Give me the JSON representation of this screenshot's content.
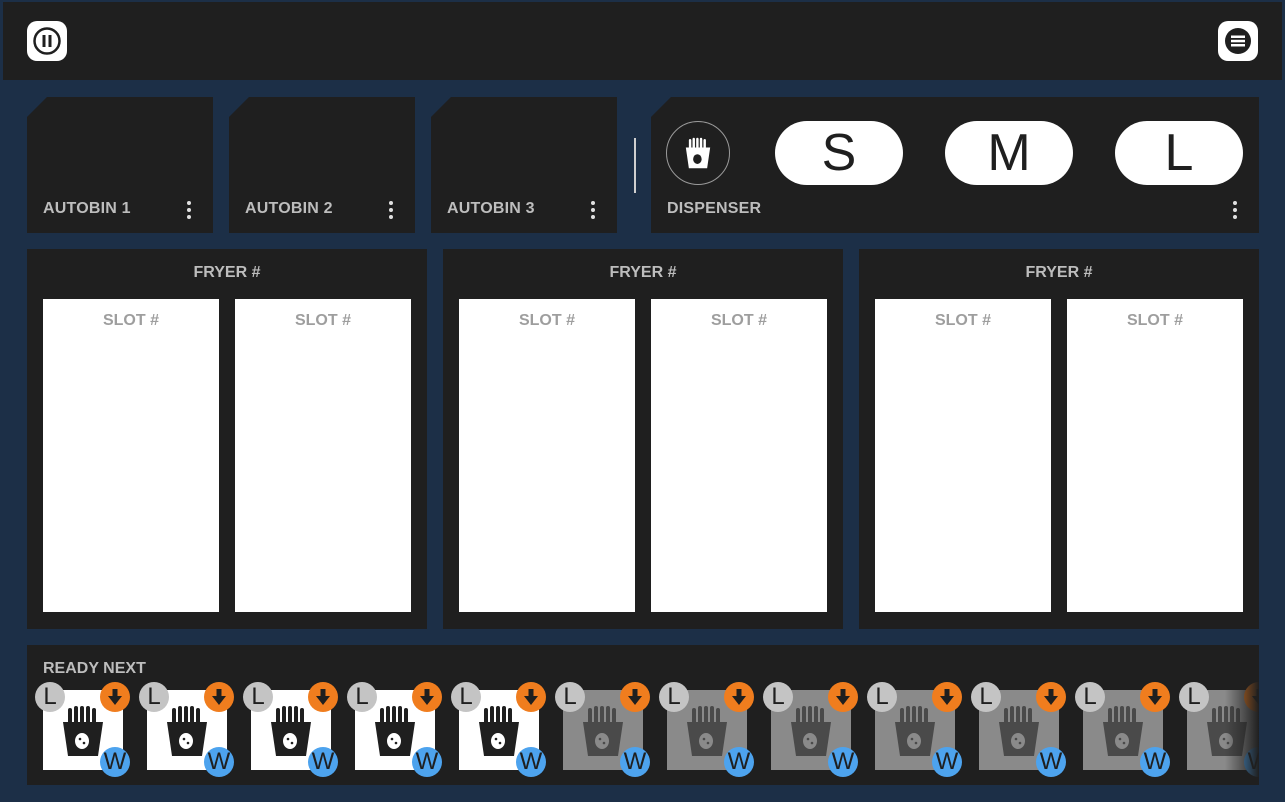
{
  "autobins": [
    {
      "label": "AUTOBIN 1"
    },
    {
      "label": "AUTOBIN 2"
    },
    {
      "label": "AUTOBIN 3"
    }
  ],
  "dispenser": {
    "label": "DISPENSER",
    "sizes": [
      "S",
      "M",
      "L"
    ]
  },
  "fryers": [
    {
      "title": "FRYER #",
      "slots": [
        "SLOT #",
        "SLOT #"
      ]
    },
    {
      "title": "FRYER #",
      "slots": [
        "SLOT #",
        "SLOT #"
      ]
    },
    {
      "title": "FRYER #",
      "slots": [
        "SLOT #",
        "SLOT #"
      ]
    }
  ],
  "ready_next": {
    "title": "READY NEXT",
    "items": [
      {
        "size": "L",
        "tag": "W",
        "state": "ready"
      },
      {
        "size": "L",
        "tag": "W",
        "state": "ready"
      },
      {
        "size": "L",
        "tag": "W",
        "state": "ready"
      },
      {
        "size": "L",
        "tag": "W",
        "state": "ready"
      },
      {
        "size": "L",
        "tag": "W",
        "state": "ready"
      },
      {
        "size": "L",
        "tag": "W",
        "state": "pending"
      },
      {
        "size": "L",
        "tag": "W",
        "state": "pending"
      },
      {
        "size": "L",
        "tag": "W",
        "state": "pending"
      },
      {
        "size": "L",
        "tag": "W",
        "state": "pending"
      },
      {
        "size": "L",
        "tag": "W",
        "state": "pending"
      },
      {
        "size": "L",
        "tag": "W",
        "state": "pending"
      },
      {
        "size": "L",
        "tag": "W",
        "state": "pending"
      }
    ]
  },
  "colors": {
    "background": "#1c2f47",
    "panel": "#1f1f1f",
    "size_badge": "#c4c4c4",
    "drop_badge": "#f07d1e",
    "w_badge": "#4da3ee"
  },
  "icons": {
    "pause": "pause-icon",
    "menu": "menu-icon",
    "dispenser": "fries-icon",
    "kebab": "more-vert-icon",
    "drop": "arrow-down-icon"
  }
}
